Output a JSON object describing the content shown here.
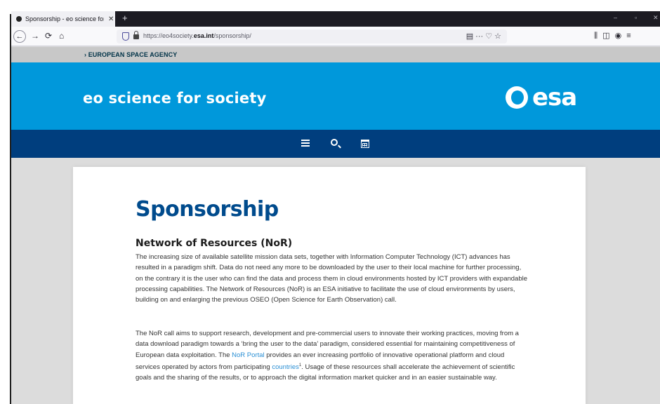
{
  "browser": {
    "tab_title": "Sponsorship - eo science for so",
    "tab_close": "✕",
    "new_tab": "+",
    "window_controls": {
      "minimize": "–",
      "restore": "▫",
      "close": "✕"
    },
    "nav": {
      "back": "←",
      "forward": "→",
      "reload": "⟳",
      "home": "⌂"
    },
    "url_prefix": "https://eo4society.",
    "url_domain": "esa.int",
    "url_path": "/sponsorship/",
    "url_actions": "▤   ···  ♡  ☆",
    "toolbar_right": "⫼  ◫  ◉  ≡"
  },
  "site": {
    "agency_link": "› EUROPEAN SPACE AGENCY",
    "title": "eo science for society",
    "logo_text": "esa"
  },
  "page": {
    "heading": "Sponsorship",
    "section_heading": "Network of Resources (NoR)",
    "para1": "The increasing size of available satellite mission data sets, together with Information Computer Technology (ICT) advances has resulted in a paradigm shift. Data do not need any more to be downloaded by the user to their local machine for further processing, on the contrary it is the user who can find the data and process them in cloud environments hosted by ICT providers with expandable processing capabilities. The Network of Resources (NoR) is an ESA initiative to facilitate the use of cloud environments by users, building on and enlarging the previous OSEO (Open Science for Earth Observation) call.",
    "para2_a": "The NoR call aims to support research, development and pre-commercial users to innovate their working practices, moving from a data download paradigm towards a ‘bring the user to the data’ paradigm, considered essential for maintaining competitiveness of European data exploitation. The ",
    "para2_link1": "NoR Portal",
    "para2_b": " provides an ever increasing portfolio of innovative operational platform and cloud services operated by actors from participating ",
    "para2_link2": "countries",
    "para2_sup": "1",
    "para2_c": ". Usage of these resources shall accelerate the achievement of scientific goals and the sharing of the results, or to approach the digital information market quicker and in an easier sustainable way."
  },
  "colors": {
    "hero_blue": "#0098db",
    "menu_navy": "#003e7e",
    "heading_blue": "#004b8d",
    "link_blue": "#2a8fd4"
  }
}
